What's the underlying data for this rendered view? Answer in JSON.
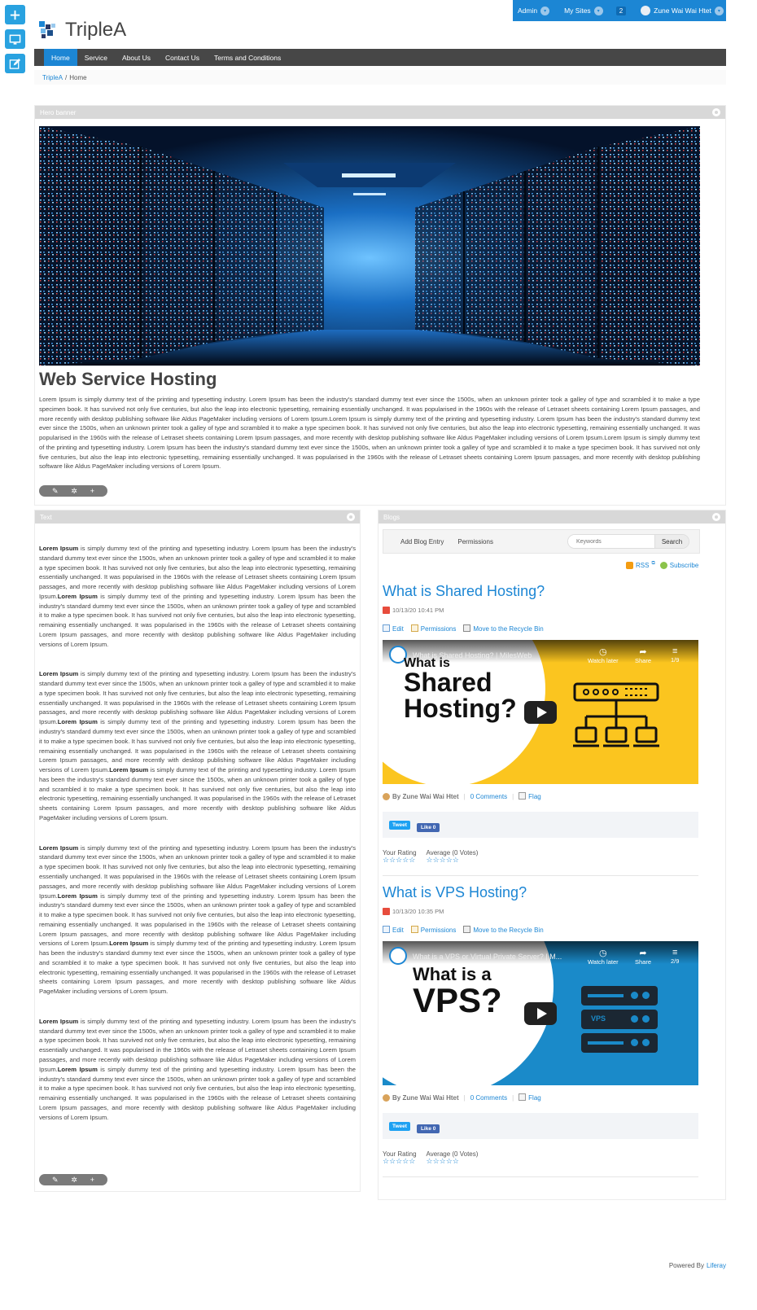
{
  "colors": {
    "accent": "#1c86d4",
    "dock": "#29a2e0",
    "nav_bg": "#474747",
    "portlet_head": "#d8d8d8"
  },
  "dock": {
    "items": [
      {
        "icon": "plus-icon"
      },
      {
        "icon": "monitor-icon"
      },
      {
        "icon": "edit-icon"
      }
    ]
  },
  "topbar": {
    "admin": "Admin",
    "my_sites": "My Sites",
    "notifications": "2",
    "user": "Zune Wai Wai Htet"
  },
  "site": {
    "name": "TripleA"
  },
  "nav": {
    "items": [
      "Home",
      "Service",
      "About Us",
      "Contact Us",
      "Terms and Conditions"
    ]
  },
  "breadcrumb": {
    "root": "TripleA",
    "separator": "/",
    "current": "Home"
  },
  "hero": {
    "portlet_title": "Hero banner",
    "heading": "Web Service Hosting",
    "body": "Lorem Ipsum is simply dummy text of the printing and typesetting industry. Lorem Ipsum has been the industry's standard dummy text ever since the 1500s, when an unknown printer took a galley of type and scrambled it to make a type specimen book. It has survived not only five centuries, but also the leap into electronic typesetting, remaining essentially unchanged. It was popularised in the 1960s with the release of Letraset sheets containing Lorem Ipsum passages, and more recently with desktop publishing software like Aldus PageMaker including versions of Lorem Ipsum.Lorem Ipsum is simply dummy text of the printing and typesetting industry. Lorem Ipsum has been the industry's standard dummy text ever since the 1500s, when an unknown printer took a galley of type and scrambled it to make a type specimen book. It has survived not only five centuries, but also the leap into electronic typesetting, remaining essentially unchanged. It was popularised in the 1960s with the release of Letraset sheets containing Lorem Ipsum passages, and more recently with desktop publishing software like Aldus PageMaker including versions of Lorem Ipsum.Lorem Ipsum is simply dummy text of the printing and typesetting industry. Lorem Ipsum has been the industry's standard dummy text ever since the 1500s, when an unknown printer took a galley of type and scrambled it to make a type specimen book. It has survived not only five centuries, but also the leap into electronic typesetting, remaining essentially unchanged. It was popularised in the 1960s with the release of Letraset sheets containing Lorem Ipsum passages, and more recently with desktop publishing software like Aldus PageMaker including versions of Lorem Ipsum."
  },
  "text_portlet": {
    "title": "Text",
    "bold": "Lorem Ipsum",
    "paragraphs": [
      {
        "a": " is simply dummy text of the printing and typesetting industry. Lorem Ipsum has been the industry's standard dummy text ever since the 1500s, when an unknown printer took a galley of type and scrambled it to make a type specimen book. It has survived not only five centuries, but also the leap into electronic typesetting, remaining essentially unchanged. It was popularised in the 1960s with the release of Letraset sheets containing Lorem Ipsum passages, and more recently with desktop publishing software like Aldus PageMaker including versions of Lorem Ipsum.",
        "b": " is simply dummy text of the printing and typesetting industry. Lorem Ipsum has been the industry's standard dummy text ever since the 1500s, when an unknown printer took a galley of type and scrambled it to make a type specimen book. It has survived not only five centuries, but also the leap into electronic typesetting, remaining essentially unchanged. It was popularised in the 1960s with the release of Letraset sheets containing Lorem Ipsum passages, and more recently with desktop publishing software like Aldus PageMaker including versions of Lorem Ipsum.",
        "c": ""
      },
      {
        "a": " is simply dummy text of the printing and typesetting industry. Lorem Ipsum has been the industry's standard dummy text ever since the 1500s, when an unknown printer took a galley of type and scrambled it to make a type specimen book. It has survived not only five centuries, but also the leap into electronic typesetting, remaining essentially unchanged. It was popularised in the 1960s with the release of Letraset sheets containing Lorem Ipsum passages, and more recently with desktop publishing software like Aldus PageMaker including versions of Lorem Ipsum.",
        "b": " is simply dummy text of the printing and typesetting industry. Lorem Ipsum has been the industry's standard dummy text ever since the 1500s, when an unknown printer took a galley of type and scrambled it to make a type specimen book. It has survived not only five centuries, but also the leap into electronic typesetting, remaining essentially unchanged. It was popularised in the 1960s with the release of Letraset sheets containing Lorem Ipsum passages, and more recently with desktop publishing software like Aldus PageMaker including versions of Lorem Ipsum.",
        "c": " is simply dummy text of the printing and typesetting industry. Lorem Ipsum has been the industry's standard dummy text ever since the 1500s, when an unknown printer took a galley of type and scrambled it to make a type specimen book. It has survived not only five centuries, but also the leap into electronic typesetting, remaining essentially unchanged. It was popularised in the 1960s with the release of Letraset sheets containing Lorem Ipsum passages, and more recently with desktop publishing software like Aldus PageMaker including versions of Lorem Ipsum."
      },
      {
        "a": " is simply dummy text of the printing and typesetting industry. Lorem Ipsum has been the industry's standard dummy text ever since the 1500s, when an unknown printer took a galley of type and scrambled it to make a type specimen book. It has survived not only five centuries, but also the leap into electronic typesetting, remaining essentially unchanged. It was popularised in the 1960s with the release of Letraset sheets containing Lorem Ipsum passages, and more recently with desktop publishing software like Aldus PageMaker including versions of Lorem Ipsum.",
        "b": " is simply dummy text of the printing and typesetting industry. Lorem Ipsum has been the industry's standard dummy text ever since the 1500s, when an unknown printer took a galley of type and scrambled it to make a type specimen book. It has survived not only five centuries, but also the leap into electronic typesetting, remaining essentially unchanged. It was popularised in the 1960s with the release of Letraset sheets containing Lorem Ipsum passages, and more recently with desktop publishing software like Aldus PageMaker including versions of Lorem Ipsum.",
        "c": " is simply dummy text of the printing and typesetting industry. Lorem Ipsum has been the industry's standard dummy text ever since the 1500s, when an unknown printer took a galley of type and scrambled it to make a type specimen book. It has survived not only five centuries, but also the leap into electronic typesetting, remaining essentially unchanged. It was popularised in the 1960s with the release of Letraset sheets containing Lorem Ipsum passages, and more recently with desktop publishing software like Aldus PageMaker including versions of Lorem Ipsum."
      },
      {
        "a": " is simply dummy text of the printing and typesetting industry. Lorem Ipsum has been the industry's standard dummy text ever since the 1500s, when an unknown printer took a galley of type and scrambled it to make a type specimen book. It has survived not only five centuries, but also the leap into electronic typesetting, remaining essentially unchanged. It was popularised in the 1960s with the release of Letraset sheets containing Lorem Ipsum passages, and more recently with desktop publishing software like Aldus PageMaker including versions of Lorem Ipsum.",
        "b": " is simply dummy text of the printing and typesetting industry. Lorem Ipsum has been the industry's standard dummy text ever since the 1500s, when an unknown printer took a galley of type and scrambled it to make a type specimen book. It has survived not only five centuries, but also the leap into electronic typesetting, remaining essentially unchanged. It was popularised in the 1960s with the release of Letraset sheets containing Lorem Ipsum passages, and more recently with desktop publishing software like Aldus PageMaker including versions of Lorem Ipsum.",
        "c": ""
      }
    ]
  },
  "blogs": {
    "portlet_title": "Blogs",
    "add_entry": "Add Blog Entry",
    "permissions": "Permissions",
    "search_placeholder": "Keywords",
    "search_button": "Search",
    "rss": "RSS",
    "subscribe": "Subscribe",
    "entries": [
      {
        "title": "What is Shared Hosting?",
        "date": "10/13/20 10:41 PM",
        "actions": [
          "Edit",
          "Permissions",
          "Move to the Recycle Bin"
        ],
        "video": {
          "title": "What is Shared Hosting? | MilesWeb",
          "headline_1": "What is",
          "headline_2": "Shared",
          "headline_3": "Hosting?",
          "watch_later": "Watch later",
          "share": "Share",
          "counter": "1/9"
        },
        "author": "By Zune Wai Wai Htet",
        "comments": "0 Comments",
        "flag": "Flag",
        "tweet": "Tweet",
        "like": "Like 0",
        "your_rating": "Your Rating",
        "average": "Average (0 Votes)"
      },
      {
        "title": "What is VPS Hosting?",
        "date": "10/13/20 10:35 PM",
        "actions": [
          "Edit",
          "Permissions",
          "Move to the Recycle Bin"
        ],
        "video": {
          "title": "What is a VPS or Virtual Private Server? | M...",
          "headline_1": "What is a",
          "headline_2": "VPS?",
          "server_label": "VPS",
          "watch_later": "Watch later",
          "share": "Share",
          "counter": "2/9"
        },
        "author": "By Zune Wai Wai Htet",
        "comments": "0 Comments",
        "flag": "Flag",
        "tweet": "Tweet",
        "like": "Like 0",
        "your_rating": "Your Rating",
        "average": "Average (0 Votes)"
      }
    ]
  },
  "footer": {
    "powered_by": "Powered By",
    "brand": "Liferay"
  }
}
